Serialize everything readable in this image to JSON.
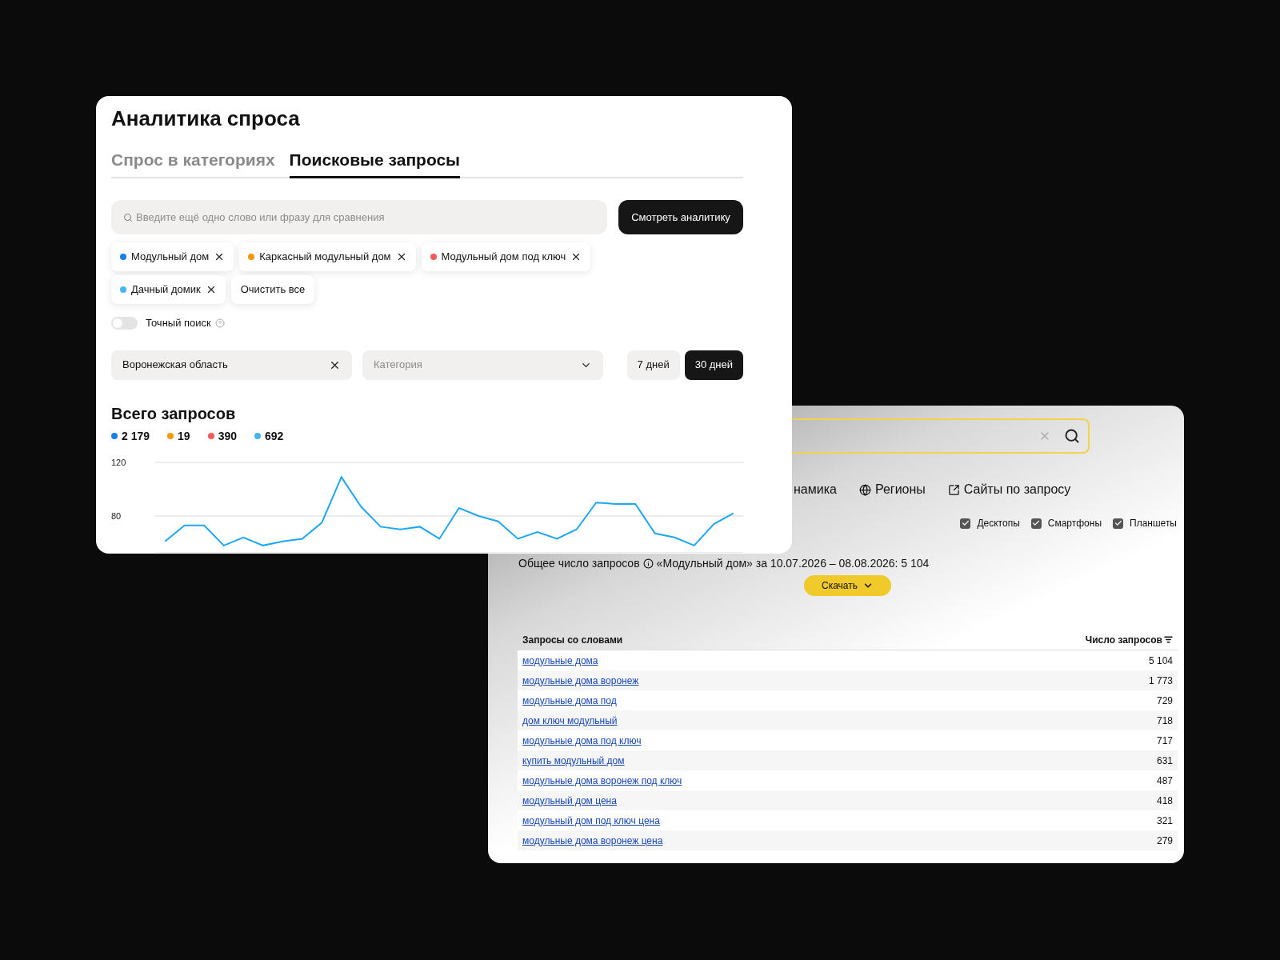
{
  "app": {
    "title": "Аналитика спроса"
  },
  "tabs": [
    {
      "label": "Спрос в категориях",
      "selected": false
    },
    {
      "label": "Поисковые запросы",
      "selected": true
    }
  ],
  "search": {
    "placeholder": "Введите ещё одно слово или фразу для сравнения",
    "button": "Смотреть аналитику"
  },
  "chips": [
    {
      "label": "Модульный дом",
      "color": "#1a7ee6"
    },
    {
      "label": "Каркасный модульный дом",
      "color": "#f59a0b"
    },
    {
      "label": "Модульный дом под ключ",
      "color": "#f25c5c"
    },
    {
      "label": "Дачный домик",
      "color": "#45b6f5"
    }
  ],
  "clear_all": "Очистить все",
  "exact_search": {
    "label": "Точный поиск",
    "on": false
  },
  "filters": {
    "region": "Воронежская область",
    "category_placeholder": "Категория"
  },
  "periods": [
    {
      "label": "7 дней",
      "selected": false
    },
    {
      "label": "30 дней",
      "selected": true
    }
  ],
  "totals": {
    "title": "Всего запросов",
    "items": [
      {
        "value": "2 179",
        "color": "#1a7ee6"
      },
      {
        "value": "19",
        "color": "#f59a0b"
      },
      {
        "value": "390",
        "color": "#f25c5c"
      },
      {
        "value": "692",
        "color": "#45b6f5"
      }
    ]
  },
  "chart_data": {
    "type": "line",
    "categories": [
      null,
      null,
      null,
      null,
      null,
      null,
      null,
      null,
      null,
      null,
      null,
      null,
      null,
      null,
      null,
      null,
      null,
      null,
      null,
      null,
      null,
      null,
      null,
      null,
      null,
      null,
      null,
      null,
      null,
      null
    ],
    "ylim": [
      52,
      120
    ],
    "yticks": [
      80,
      120
    ],
    "series": [
      {
        "color": "#1ea7f5",
        "values": [
          61,
          73,
          73,
          58,
          64,
          58,
          61,
          63,
          75,
          109,
          87,
          72,
          70,
          72,
          63,
          86,
          80,
          76,
          63,
          68,
          63,
          70,
          90,
          89,
          89,
          67,
          64,
          58,
          74,
          82
        ]
      }
    ]
  },
  "wordstat": {
    "tabs": [
      "намика",
      "Регионы",
      "Сайты по запросу"
    ],
    "devices": [
      {
        "label": "Десктопы",
        "checked": true
      },
      {
        "label": "Смартфоны",
        "checked": true
      },
      {
        "label": "Планшеты",
        "checked": true
      }
    ],
    "summary": [
      "Общее число запросов",
      "«Модульный дом» за 10.07.2026 – 08.08.2026: 5 104"
    ],
    "download": "Скачать",
    "table": {
      "columns": [
        "Запросы со словами",
        "Число запросов"
      ],
      "rows": [
        {
          "query": "модульные дома",
          "count": "5 104"
        },
        {
          "query": "модульные дома воронеж",
          "count": "1 773"
        },
        {
          "query": "модульные дома под",
          "count": "729"
        },
        {
          "query": "дом ключ модульный",
          "count": "718"
        },
        {
          "query": "модульные дома под ключ",
          "count": "717"
        },
        {
          "query": "купить модульный дом",
          "count": "631"
        },
        {
          "query": "модульные дома воронеж под ключ",
          "count": "487"
        },
        {
          "query": "модульный дом цена",
          "count": "418"
        },
        {
          "query": "модульный дом под ключ цена",
          "count": "321"
        },
        {
          "query": "модульные дома воронеж цена",
          "count": "279"
        }
      ]
    }
  }
}
